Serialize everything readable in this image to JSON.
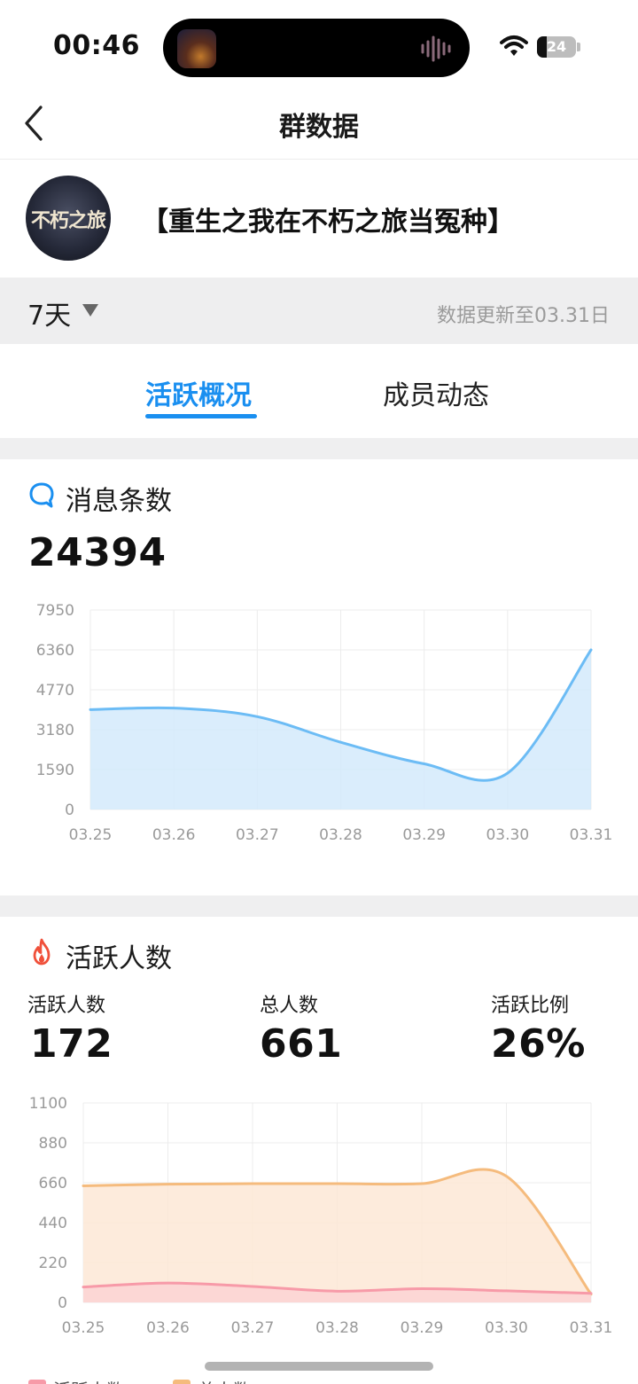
{
  "status_bar": {
    "time": "00:46",
    "battery": "24",
    "battery_level": 0.24
  },
  "nav": {
    "title": "群数据"
  },
  "group": {
    "name": "【重生之我在不朽之旅当冤种】",
    "avatar_text": "不朽之旅"
  },
  "filter": {
    "range": "7天",
    "updated": "数据更新至03.31日"
  },
  "tabs": [
    {
      "label": "活跃概况",
      "active": true
    },
    {
      "label": "成员动态",
      "active": false
    }
  ],
  "messages": {
    "title": "消息条数",
    "total": "24394",
    "icon": "chat-bubble-icon",
    "color": "#1a8ff0"
  },
  "active": {
    "title": "活跃人数",
    "icon": "flame-icon",
    "color": "#f0503a",
    "stats": [
      {
        "label": "活跃人数",
        "value": "172"
      },
      {
        "label": "总人数",
        "value": "661"
      },
      {
        "label": "活跃比例",
        "value": "26%"
      }
    ]
  },
  "legend": [
    {
      "label": "活跃人数",
      "color": "#f79aa8"
    },
    {
      "label": "总人数",
      "color": "#f5bb7d"
    }
  ],
  "chart_data": [
    {
      "type": "area",
      "title": "",
      "x": [
        "03.25",
        "03.26",
        "03.27",
        "03.28",
        "03.29",
        "03.30",
        "03.31"
      ],
      "yticks": [
        0,
        1590,
        3180,
        4770,
        6360,
        7950
      ],
      "ylim": [
        0,
        7950
      ],
      "grid": true,
      "series": [
        {
          "values": [
            3980,
            4040,
            3700,
            2680,
            1820,
            1450,
            6360
          ],
          "color": "#6cbcf5",
          "fill": "#d4eafb"
        }
      ]
    },
    {
      "type": "area",
      "title": "",
      "x": [
        "03.25",
        "03.26",
        "03.27",
        "03.28",
        "03.29",
        "03.30",
        "03.31"
      ],
      "yticks": [
        0,
        220,
        440,
        660,
        880,
        1100
      ],
      "ylim": [
        0,
        1100
      ],
      "grid": true,
      "series": [
        {
          "name": "总人数",
          "values": [
            643,
            652,
            655,
            655,
            655,
            696,
            45
          ],
          "color": "#f5bb7d",
          "fill": "#fde7d6"
        },
        {
          "name": "活跃人数",
          "values": [
            85,
            107,
            88,
            62,
            76,
            64,
            50
          ],
          "color": "#f79aa8",
          "fill": "#fcd3d4"
        }
      ]
    }
  ]
}
